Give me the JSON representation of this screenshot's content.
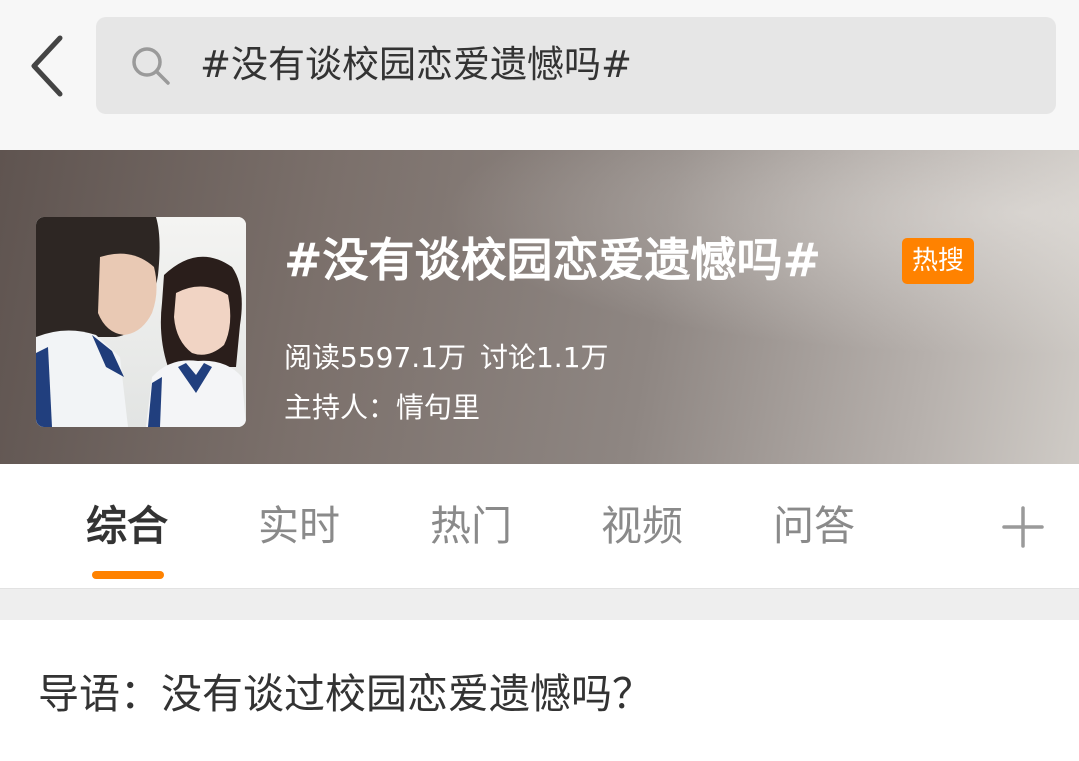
{
  "header": {
    "back_icon": "chevron-left-icon",
    "search_icon": "search-icon",
    "search_text": "#没有谈校园恋爱遗憾吗#"
  },
  "topic": {
    "title": "#没有谈校园恋爱遗憾吗#",
    "badge": "热搜",
    "badge_color": "#ff8200",
    "reads": "阅读5597.1万",
    "discussions": "讨论1.1万",
    "host": "主持人：情句里"
  },
  "tabs": [
    {
      "label": "综合",
      "active": true
    },
    {
      "label": "实时",
      "active": false
    },
    {
      "label": "热门",
      "active": false
    },
    {
      "label": "视频",
      "active": false
    },
    {
      "label": "问答",
      "active": false
    }
  ],
  "tabs_more_icon": "plus-icon",
  "accent_color": "#ff8200",
  "content": {
    "intro": "导语：没有谈过校园恋爱遗憾吗？"
  }
}
